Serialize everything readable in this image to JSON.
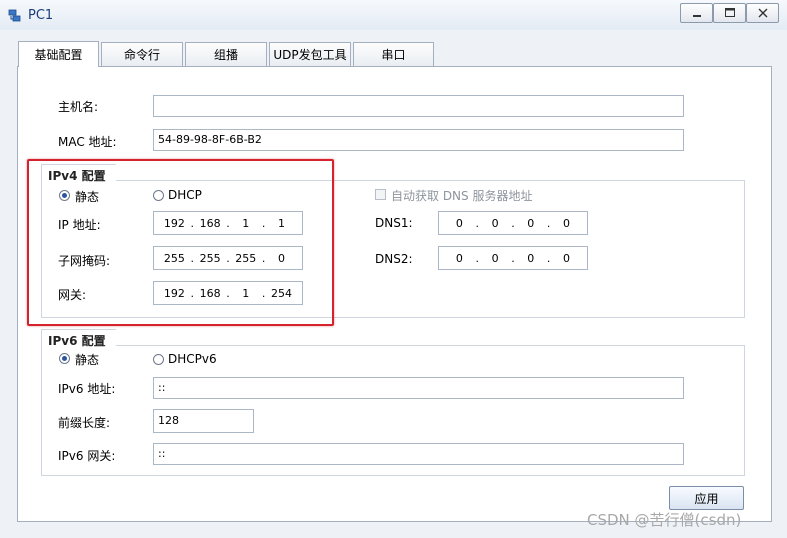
{
  "window": {
    "title": "PC1",
    "controls": {
      "minimize": "minimize",
      "maximize": "maximize",
      "close": "close"
    }
  },
  "tabs": [
    {
      "label": "基础配置",
      "active": true
    },
    {
      "label": "命令行",
      "active": false
    },
    {
      "label": "组播",
      "active": false
    },
    {
      "label": "UDP发包工具",
      "active": false
    },
    {
      "label": "串口",
      "active": false
    }
  ],
  "host": {
    "hostname_label": "主机名:",
    "hostname_value": "",
    "mac_label": "MAC 地址:",
    "mac_value": "54-89-98-8F-6B-B2"
  },
  "ipv4": {
    "group_title": "IPv4 配置",
    "static_label": "静态",
    "dhcp_label": "DHCP",
    "mode": "static",
    "auto_dns_label": "自动获取 DNS 服务器地址",
    "ip_label": "IP 地址:",
    "ip": [
      "192",
      "168",
      "1",
      "1"
    ],
    "mask_label": "子网掩码:",
    "mask": [
      "255",
      "255",
      "255",
      "0"
    ],
    "gateway_label": "网关:",
    "gateway": [
      "192",
      "168",
      "1",
      "254"
    ],
    "dns1_label": "DNS1:",
    "dns1": [
      "0",
      "0",
      "0",
      "0"
    ],
    "dns2_label": "DNS2:",
    "dns2": [
      "0",
      "0",
      "0",
      "0"
    ]
  },
  "ipv6": {
    "group_title": "IPv6 配置",
    "static_label": "静态",
    "dhcp_label": "DHCPv6",
    "mode": "static",
    "ip_label": "IPv6 地址:",
    "ip_value": "::",
    "prefix_label": "前缀长度:",
    "prefix_value": "128",
    "gateway_label": "IPv6 网关:",
    "gateway_value": "::"
  },
  "apply_label": "应用",
  "watermark": "CSDN @苦行僧(csdn)",
  "colors": {
    "highlight": "#d4232d",
    "title": "#1b3d79",
    "radio_dot": "#2a55a3"
  }
}
